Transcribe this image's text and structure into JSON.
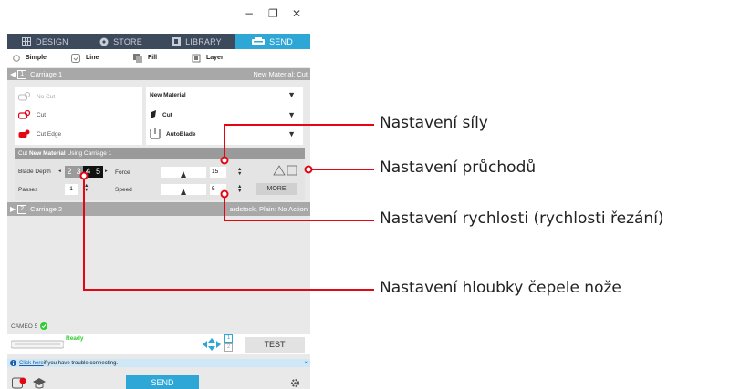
{
  "window": {
    "minimize": "−",
    "maximize": "❐",
    "close": "✕"
  },
  "tabs": [
    {
      "label": "DESIGN",
      "icon": "grid-icon",
      "active": false
    },
    {
      "label": "STORE",
      "icon": "store-icon",
      "active": false
    },
    {
      "label": "LIBRARY",
      "icon": "library-icon",
      "active": false
    },
    {
      "label": "SEND",
      "icon": "send-icon",
      "active": true
    }
  ],
  "modes": [
    "Simple",
    "Line",
    "Fill",
    "Layer"
  ],
  "carriage1": {
    "number": "1",
    "title": "Carriage 1",
    "material_short": "New Material: Cut"
  },
  "cut_options": [
    "No Cut",
    "Cut",
    "Cut Edge"
  ],
  "material": {
    "name": "New Material",
    "action": "Cut",
    "tool": "AutoBlade"
  },
  "cut_bar": {
    "prefix": "Cut",
    "material": "New Material",
    "suffix": "Using Carriage 1"
  },
  "settings": {
    "blade_depth_label": "Blade Depth",
    "blade_depth_values": [
      "2",
      "3",
      "4",
      "5"
    ],
    "blade_depth_selected": "4",
    "passes_label": "Passes",
    "passes_value": "1",
    "force_label": "Force",
    "force_value": "15",
    "speed_label": "Speed",
    "speed_value": "5",
    "more_label": "MORE"
  },
  "carriage2": {
    "number": "2",
    "title": "Carriage 2",
    "material_short": "ardstock, Plain: No Action"
  },
  "device": {
    "name": "CAMEO 5",
    "status": "Ready"
  },
  "carriage_indicators": [
    "1",
    "2"
  ],
  "test_label": "TEST",
  "info_bar": {
    "link": "Click here",
    "text": " if you have trouble connecting.",
    "close": "×"
  },
  "send_label": "SEND",
  "callouts": {
    "force": "Nastavení síly",
    "passes": "Nastavení průchodů",
    "speed": "Nastavení rychlosti (rychlosti řezání)",
    "blade_depth": "Nastavení hloubky čepele nože"
  },
  "colors": {
    "accent": "#2ea6d6",
    "tabbar": "#3d4a5c",
    "callout_red": "#e30613",
    "ready_green": "#2ecc2e"
  }
}
